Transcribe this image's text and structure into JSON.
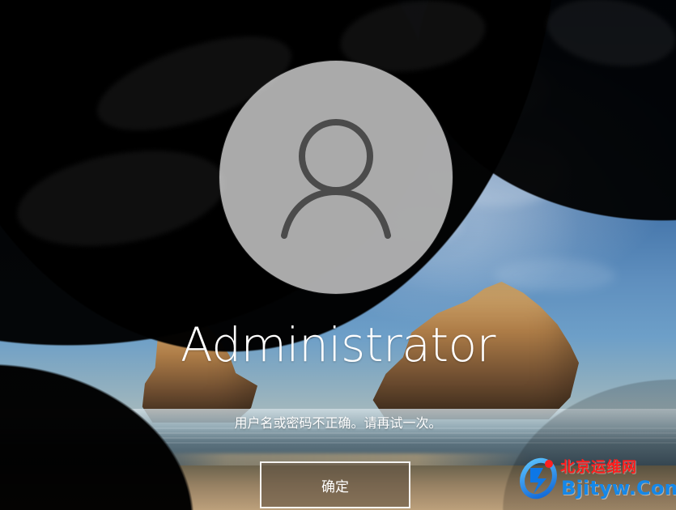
{
  "account": {
    "name": "Administrator"
  },
  "error": {
    "message": "用户名或密码不正确。请再试一次。"
  },
  "actions": {
    "ok_label": "确定"
  },
  "watermark": {
    "top_text": "北京运维网",
    "bottom_text": "Bjityw.Com"
  },
  "icons": {
    "avatar": "user-icon",
    "logo": "bjityw-logo"
  },
  "colors": {
    "avatar_bg": "#d9d9d9",
    "text": "#ffffff",
    "watermark_red": "#ff1d1d",
    "watermark_blue": "#1688e8"
  }
}
